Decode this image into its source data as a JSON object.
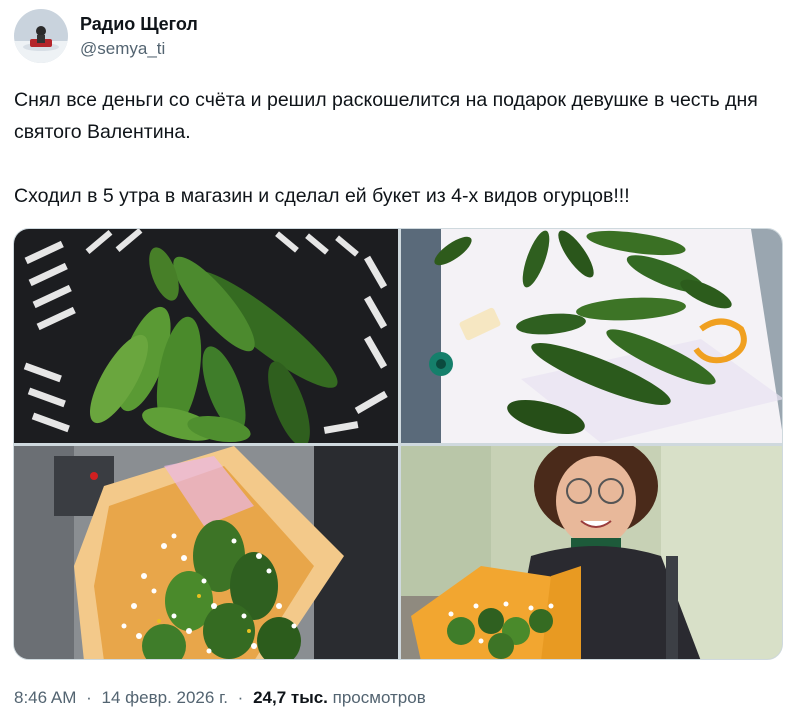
{
  "author": {
    "name": "Радио Щегол",
    "handle": "@semya_ti"
  },
  "tweet": {
    "paragraphs": [
      "Снял все деньги со счёта и решил раскошелится на подарок девушке в честь дня святого Валентина.",
      "Сходил в 5 утра в магазин и сделал ей букет из 4-х видов огурцов!!!"
    ]
  },
  "media": {
    "photos": [
      "cucumbers-in-basket-photo",
      "cucumbers-on-wrapping-foil-photo",
      "cucumber-bouquet-photo",
      "woman-holding-bouquet-photo"
    ]
  },
  "meta": {
    "time": "8:46 AM",
    "separator": "·",
    "date": "14 февр. 2026 г.",
    "views_count": "24,7 тыс.",
    "views_label": "просмотров"
  },
  "colors": {
    "text": "#0f1419",
    "secondary": "#536471",
    "cucumber": "#3f7d2a"
  }
}
